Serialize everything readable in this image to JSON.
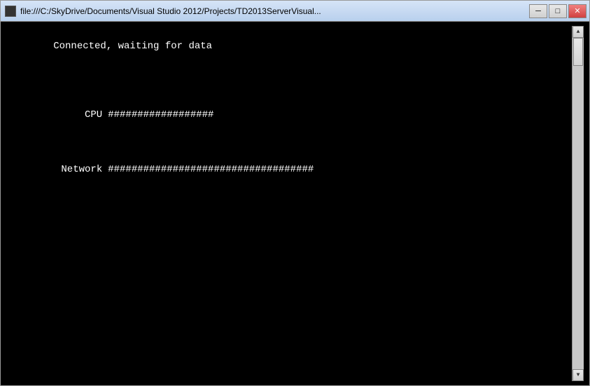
{
  "window": {
    "title": "file:///C:/SkyDrive/Documents/Visual Studio 2012/Projects/TD2013ServerVisual...",
    "icon_label": "window-icon"
  },
  "titlebar": {
    "minimize_label": "─",
    "maximize_label": "□",
    "close_label": "✕"
  },
  "console": {
    "line1": "Connected, waiting for data",
    "line2": "",
    "line3": "",
    "cpu_label": "CPU",
    "cpu_bar": "##################",
    "network_label": "Network",
    "network_bar": "###################################"
  }
}
